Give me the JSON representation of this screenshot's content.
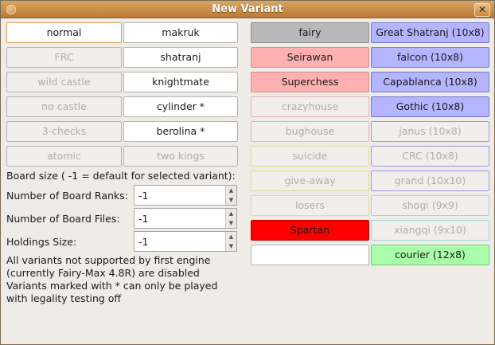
{
  "window": {
    "title": "New Variant"
  },
  "left_column": [
    {
      "label": "normal",
      "enabled": true
    },
    {
      "label": "FRC",
      "enabled": false
    },
    {
      "label": "wild castle",
      "enabled": false
    },
    {
      "label": "no castle",
      "enabled": false
    },
    {
      "label": "3-checks",
      "enabled": false
    },
    {
      "label": "atomic",
      "enabled": false
    }
  ],
  "second_column": [
    {
      "label": "makruk",
      "enabled": true
    },
    {
      "label": "shatranj",
      "enabled": true
    },
    {
      "label": "knightmate",
      "enabled": true
    },
    {
      "label": "cylinder *",
      "enabled": true
    },
    {
      "label": "berolina *",
      "enabled": true
    },
    {
      "label": "two kings",
      "enabled": false
    }
  ],
  "third_column": [
    {
      "label": "fairy",
      "enabled": true
    },
    {
      "label": "Seirawan",
      "enabled": true
    },
    {
      "label": "Superchess",
      "enabled": true
    },
    {
      "label": "crazyhouse",
      "enabled": false
    },
    {
      "label": "bughouse",
      "enabled": false
    },
    {
      "label": "suicide",
      "enabled": false
    },
    {
      "label": "give-away",
      "enabled": false
    },
    {
      "label": "losers",
      "enabled": false
    },
    {
      "label": "Spartan",
      "enabled": true
    },
    {
      "label": "",
      "enabled": true
    }
  ],
  "fourth_column": [
    {
      "label": "Great Shatranj (10x8)",
      "enabled": true
    },
    {
      "label": "falcon (10x8)",
      "enabled": true
    },
    {
      "label": "Capablanca (10x8)",
      "enabled": true
    },
    {
      "label": "Gothic (10x8)",
      "enabled": true
    },
    {
      "label": "janus (10x8)",
      "enabled": false
    },
    {
      "label": "CRC (10x8)",
      "enabled": false
    },
    {
      "label": "grand (10x10)",
      "enabled": false
    },
    {
      "label": "shogi (9x9)",
      "enabled": false
    },
    {
      "label": "xiangqi (9x10)",
      "enabled": false
    },
    {
      "label": "courier (12x8)",
      "enabled": true
    }
  ],
  "colors": {
    "normal_border": "#d9a05a",
    "fairy_bg": "#b9b9b9",
    "red_light_bg": "#ffb0b0",
    "red_light_border": "#d98c8c",
    "spartan_bg": "#ff0000",
    "blue_bg": "#b4b4ff",
    "blue_border": "#7777cc",
    "yellow_border": "#e3dc9a",
    "cyan_border": "#9ed8d8",
    "green_bg": "#aaffaa",
    "green_border": "#77c777"
  },
  "board_size": {
    "heading": "Board size ( -1 = default for selected variant):",
    "ranks_label": "Number of Board Ranks:",
    "ranks_value": "-1",
    "files_label": "Number of Board Files:",
    "files_value": "-1",
    "holdings_label": "Holdings Size:",
    "holdings_value": "-1"
  },
  "notes": [
    "All variants not supported by first engine",
    "(currently Fairy-Max 4.8R) are disabled",
    "Variants marked with * can only be played",
    "with legality testing off"
  ]
}
